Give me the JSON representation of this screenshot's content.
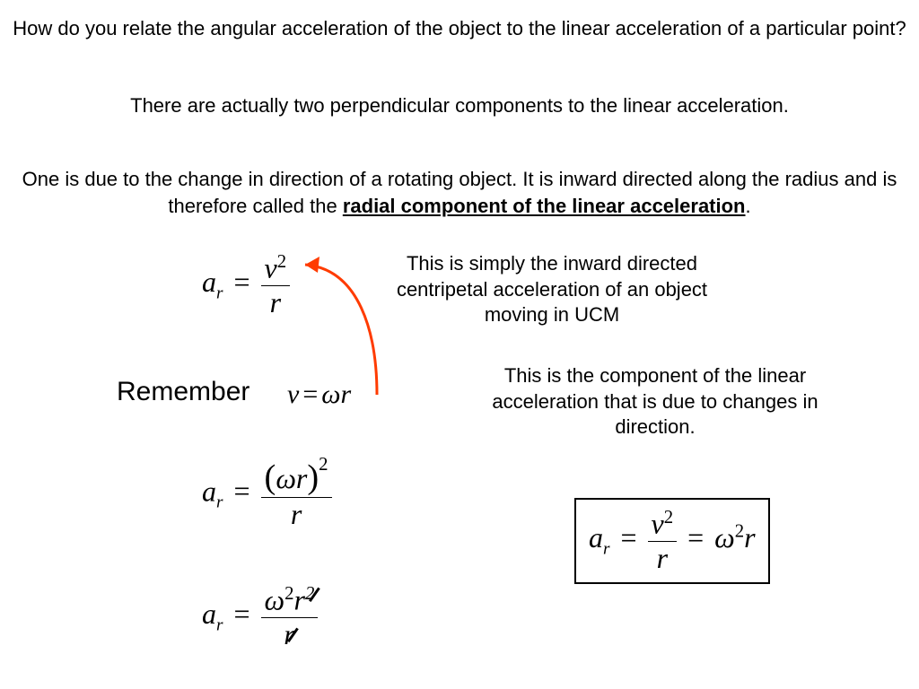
{
  "title": "How do you relate the angular acceleration of the object to the linear acceleration of a particular point?",
  "line2": "There are actually two perpendicular components to the linear acceleration.",
  "line3_pre": "One is due to the change in direction of a rotating object.  It is inward directed along the radius and is therefore called the ",
  "line3_bold": "radial component of the linear acceleration",
  "line3_post": ".",
  "note1": "This is simply the inward directed centripetal acceleration of an object moving in UCM",
  "remember": "Remember",
  "note2": "This is the component of the linear acceleration that is due to changes in direction.",
  "equations": {
    "eq1_lhs": "a",
    "eq1_sub": "r",
    "eq1_num_base": "v",
    "eq1_num_exp": "2",
    "eq1_den": "r",
    "v_eq": "v",
    "v_omega": "ω",
    "v_r": "r",
    "eq2_num_omega": "ω",
    "eq2_num_r": "r",
    "eq2_num_exp": "2",
    "eq2_den": "r",
    "eq3_num_omega": "ω",
    "eq3_num_exp": "2",
    "eq3_num_r_base": "r",
    "eq3_num_r_exp": "2",
    "eq3_den": "r",
    "box_a": "a",
    "box_sub": "r",
    "box_v": "v",
    "box_vexp": "2",
    "box_den": "r",
    "box_omega": "ω",
    "box_omegaexp": "2",
    "box_r": "r"
  },
  "colors": {
    "arrow": "#ff3b00"
  }
}
